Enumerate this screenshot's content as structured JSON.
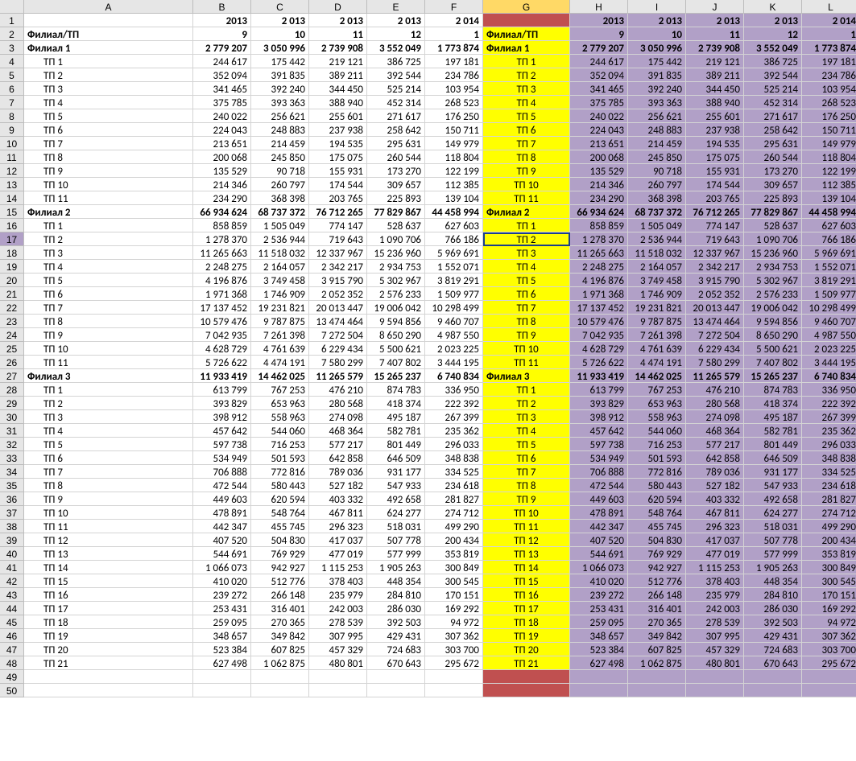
{
  "columns": [
    "A",
    "B",
    "C",
    "D",
    "E",
    "F",
    "G",
    "H",
    "I",
    "J",
    "K",
    "L"
  ],
  "active_col": "G",
  "active_row": 17,
  "header1": {
    "B": "2013",
    "C": "2 013",
    "D": "2 013",
    "E": "2 013",
    "F": "2 014",
    "H": "2013",
    "I": "2 013",
    "J": "2 013",
    "K": "2 013",
    "L": "2 014"
  },
  "header2": {
    "A": "Филиал/ТП",
    "B": "9",
    "C": "10",
    "D": "11",
    "E": "12",
    "F": "1",
    "G": "Филиал/ТП",
    "H": "9",
    "I": "10",
    "J": "11",
    "K": "12",
    "L": "1"
  },
  "rows": [
    {
      "t": "f",
      "g": "Филиал 1",
      "v": [
        "2 779 207",
        "3 050 996",
        "2 739 908",
        "3 552 049",
        "1 773 874"
      ]
    },
    {
      "t": "t",
      "g": "ТП 1",
      "v": [
        "244 617",
        "175 442",
        "219 121",
        "386 725",
        "197 181"
      ]
    },
    {
      "t": "t",
      "g": "ТП 2",
      "v": [
        "352 094",
        "391 835",
        "389 211",
        "392 544",
        "234 786"
      ]
    },
    {
      "t": "t",
      "g": "ТП 3",
      "v": [
        "341 465",
        "392 240",
        "344 450",
        "525 214",
        "103 954"
      ]
    },
    {
      "t": "t",
      "g": "ТП 4",
      "v": [
        "375 785",
        "393 363",
        "388 940",
        "452 314",
        "268 523"
      ]
    },
    {
      "t": "t",
      "g": "ТП 5",
      "v": [
        "240 022",
        "256 621",
        "255 601",
        "271 617",
        "176 250"
      ]
    },
    {
      "t": "t",
      "g": "ТП 6",
      "v": [
        "224 043",
        "248 883",
        "237 938",
        "258 642",
        "150 711"
      ]
    },
    {
      "t": "t",
      "g": "ТП 7",
      "v": [
        "213 651",
        "214 459",
        "194 535",
        "295 631",
        "149 979"
      ]
    },
    {
      "t": "t",
      "g": "ТП 8",
      "v": [
        "200 068",
        "245 850",
        "175 075",
        "260 544",
        "118 804"
      ]
    },
    {
      "t": "t",
      "g": "ТП 9",
      "v": [
        "135 529",
        "90 718",
        "155 931",
        "173 270",
        "122 199"
      ]
    },
    {
      "t": "t",
      "g": "ТП 10",
      "v": [
        "214 346",
        "260 797",
        "174 544",
        "309 657",
        "112 385"
      ]
    },
    {
      "t": "t",
      "g": "ТП 11",
      "v": [
        "234 290",
        "368 398",
        "203 765",
        "225 893",
        "139 104"
      ]
    },
    {
      "t": "f",
      "g": "Филиал 2",
      "v": [
        "66 934 624",
        "68 737 372",
        "76 712 265",
        "77 829 867",
        "44 458 994"
      ]
    },
    {
      "t": "t",
      "g": "ТП 1",
      "v": [
        "858 859",
        "1 505 049",
        "774 147",
        "528 637",
        "627 603"
      ]
    },
    {
      "t": "t",
      "g": "ТП 2",
      "v": [
        "1 278 370",
        "2 536 944",
        "719 643",
        "1 090 706",
        "766 186"
      ]
    },
    {
      "t": "t",
      "g": "ТП 3",
      "v": [
        "11 265 663",
        "11 518 032",
        "12 337 967",
        "15 236 960",
        "5 969 691"
      ]
    },
    {
      "t": "t",
      "g": "ТП 4",
      "v": [
        "2 248 275",
        "2 164 057",
        "2 342 217",
        "2 934 753",
        "1 552 071"
      ]
    },
    {
      "t": "t",
      "g": "ТП 5",
      "v": [
        "4 196 876",
        "3 749 458",
        "3 915 790",
        "5 302 967",
        "3 819 291"
      ]
    },
    {
      "t": "t",
      "g": "ТП 6",
      "v": [
        "1 971 368",
        "1 746 909",
        "2 052 352",
        "2 576 233",
        "1 509 977"
      ]
    },
    {
      "t": "t",
      "g": "ТП 7",
      "v": [
        "17 137 452",
        "19 231 821",
        "20 013 447",
        "19 006 042",
        "10 298 499"
      ]
    },
    {
      "t": "t",
      "g": "ТП 8",
      "v": [
        "10 579 476",
        "9 787 875",
        "13 474 464",
        "9 594 856",
        "9 460 707"
      ]
    },
    {
      "t": "t",
      "g": "ТП 9",
      "v": [
        "7 042 935",
        "7 261 398",
        "7 272 504",
        "8 650 290",
        "4 987 550"
      ]
    },
    {
      "t": "t",
      "g": "ТП 10",
      "v": [
        "4 628 729",
        "4 761 639",
        "6 229 434",
        "5 500 621",
        "2 023 225"
      ]
    },
    {
      "t": "t",
      "g": "ТП 11",
      "v": [
        "5 726 622",
        "4 474 191",
        "7 580 299",
        "7 407 802",
        "3 444 195"
      ]
    },
    {
      "t": "f",
      "g": "Филиал 3",
      "v": [
        "11 933 419",
        "14 462 025",
        "11 265 579",
        "15 265 237",
        "6 740 834"
      ]
    },
    {
      "t": "t",
      "g": "ТП 1",
      "v": [
        "613 799",
        "767 253",
        "476 210",
        "874 783",
        "336 950"
      ]
    },
    {
      "t": "t",
      "g": "ТП 2",
      "v": [
        "393 829",
        "653 963",
        "280 568",
        "418 374",
        "222 392"
      ]
    },
    {
      "t": "t",
      "g": "ТП 3",
      "v": [
        "398 912",
        "558 963",
        "274 098",
        "495 187",
        "267 399"
      ]
    },
    {
      "t": "t",
      "g": "ТП 4",
      "v": [
        "457 642",
        "544 060",
        "468 364",
        "582 781",
        "235 362"
      ]
    },
    {
      "t": "t",
      "g": "ТП 5",
      "v": [
        "597 738",
        "716 253",
        "577 217",
        "801 449",
        "296 033"
      ]
    },
    {
      "t": "t",
      "g": "ТП 6",
      "v": [
        "534 949",
        "501 593",
        "642 858",
        "646 509",
        "348 838"
      ]
    },
    {
      "t": "t",
      "g": "ТП 7",
      "v": [
        "706 888",
        "772 816",
        "789 036",
        "931 177",
        "334 525"
      ]
    },
    {
      "t": "t",
      "g": "ТП 8",
      "v": [
        "472 544",
        "580 443",
        "527 182",
        "547 933",
        "234 618"
      ]
    },
    {
      "t": "t",
      "g": "ТП 9",
      "v": [
        "449 603",
        "620 594",
        "403 332",
        "492 658",
        "281 827"
      ]
    },
    {
      "t": "t",
      "g": "ТП 10",
      "v": [
        "478 891",
        "548 764",
        "467 811",
        "624 277",
        "274 712"
      ]
    },
    {
      "t": "t",
      "g": "ТП 11",
      "v": [
        "442 347",
        "455 745",
        "296 323",
        "518 031",
        "499 290"
      ]
    },
    {
      "t": "t",
      "g": "ТП 12",
      "v": [
        "407 520",
        "504 830",
        "417 037",
        "507 778",
        "200 434"
      ]
    },
    {
      "t": "t",
      "g": "ТП 13",
      "v": [
        "544 691",
        "769 929",
        "477 019",
        "577 999",
        "353 819"
      ]
    },
    {
      "t": "t",
      "g": "ТП 14",
      "v": [
        "1 066 073",
        "942 927",
        "1 115 253",
        "1 905 263",
        "300 849"
      ]
    },
    {
      "t": "t",
      "g": "ТП 15",
      "v": [
        "410 020",
        "512 776",
        "378 403",
        "448 354",
        "300 545"
      ]
    },
    {
      "t": "t",
      "g": "ТП 16",
      "v": [
        "239 272",
        "266 148",
        "235 979",
        "284 810",
        "170 151"
      ]
    },
    {
      "t": "t",
      "g": "ТП 17",
      "v": [
        "253 431",
        "316 401",
        "242 003",
        "286 030",
        "169 292"
      ]
    },
    {
      "t": "t",
      "g": "ТП 18",
      "v": [
        "259 095",
        "270 365",
        "278 539",
        "392 503",
        "94 972"
      ]
    },
    {
      "t": "t",
      "g": "ТП 19",
      "v": [
        "348 657",
        "349 842",
        "307 995",
        "429 431",
        "307 362"
      ]
    },
    {
      "t": "t",
      "g": "ТП 20",
      "v": [
        "523 384",
        "607 825",
        "457 329",
        "724 683",
        "303 700"
      ]
    },
    {
      "t": "t",
      "g": "ТП 21",
      "v": [
        "627 498",
        "1 062 875",
        "480 801",
        "670 643",
        "295 672"
      ]
    }
  ],
  "total_rows": 50
}
